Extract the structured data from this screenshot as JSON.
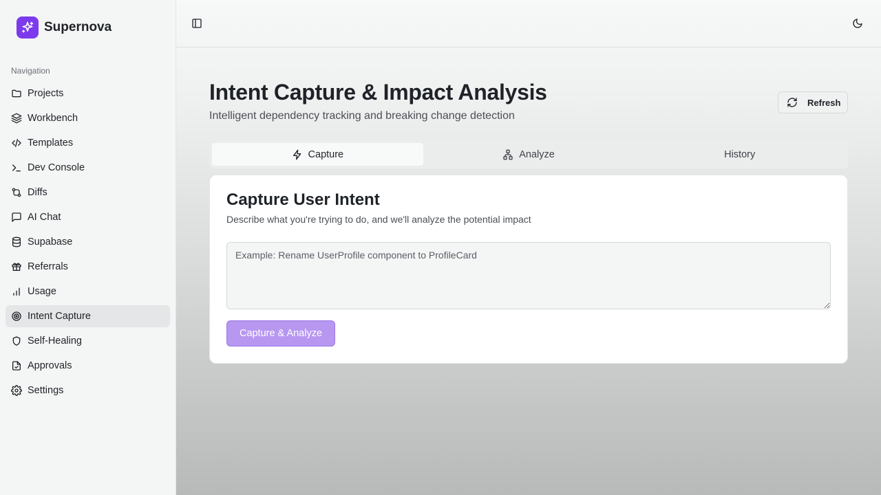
{
  "app": {
    "name": "Supernova",
    "brand_color": "#7c3aed"
  },
  "sidebar": {
    "heading": "Navigation",
    "items": [
      {
        "label": "Projects",
        "icon": "folder-icon"
      },
      {
        "label": "Workbench",
        "icon": "layers-icon"
      },
      {
        "label": "Templates",
        "icon": "code-icon"
      },
      {
        "label": "Dev Console",
        "icon": "terminal-icon"
      },
      {
        "label": "Diffs",
        "icon": "git-compare-icon"
      },
      {
        "label": "AI Chat",
        "icon": "message-square-icon"
      },
      {
        "label": "Supabase",
        "icon": "database-icon"
      },
      {
        "label": "Referrals",
        "icon": "gift-icon"
      },
      {
        "label": "Usage",
        "icon": "bar-chart-icon"
      },
      {
        "label": "Intent Capture",
        "icon": "target-icon",
        "active": true
      },
      {
        "label": "Self-Healing",
        "icon": "shield-icon"
      },
      {
        "label": "Approvals",
        "icon": "file-check-icon"
      },
      {
        "label": "Settings",
        "icon": "gear-icon"
      }
    ]
  },
  "topbar": {
    "left_icon": "sidebar-toggle-icon",
    "right_icon": "moon-icon"
  },
  "page": {
    "title": "Intent Capture & Impact Analysis",
    "subtitle": "Intelligent dependency tracking and breaking change detection",
    "refresh_label": "Refresh"
  },
  "tabs": [
    {
      "label": "Capture",
      "icon": "zap-icon",
      "active": true
    },
    {
      "label": "Analyze",
      "icon": "network-icon"
    },
    {
      "label": "History"
    }
  ],
  "card": {
    "title": "Capture User Intent",
    "description": "Describe what you're trying to do, and we'll analyze the potential impact",
    "input_value": "",
    "input_placeholder": "Example: Rename UserProfile component to ProfileCard",
    "button_label": "Capture & Analyze",
    "button_color": "#b797f0"
  }
}
